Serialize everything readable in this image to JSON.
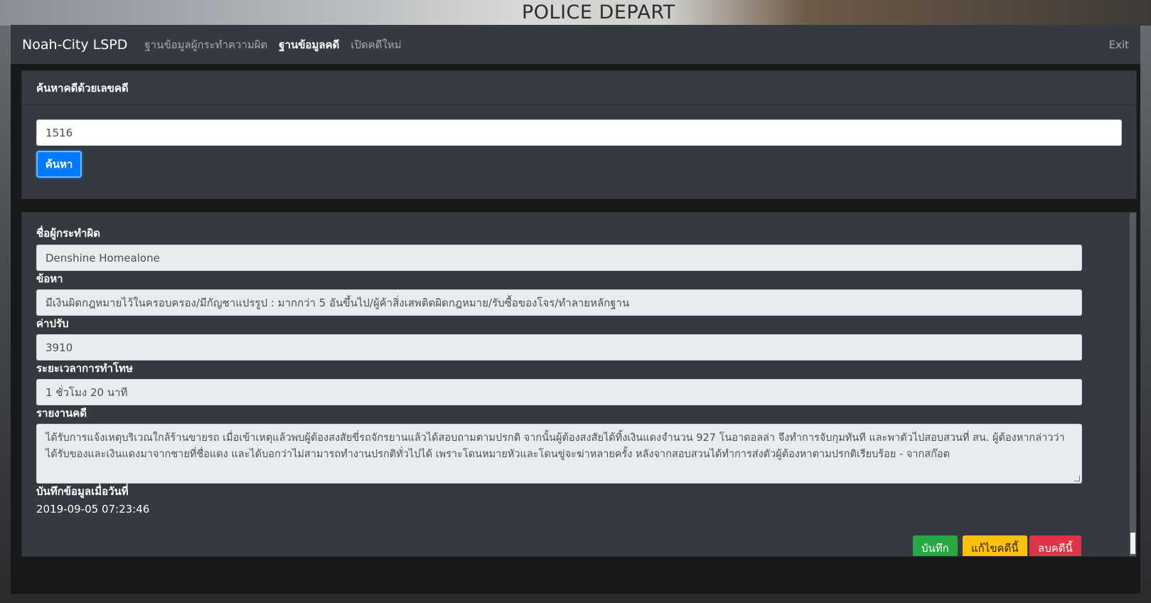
{
  "background": {
    "sign_text": "POLICE DEPART"
  },
  "navbar": {
    "brand": "Noah-City LSPD",
    "links": [
      {
        "label": "ฐานข้อมูลผู้กระทำความผิด",
        "active": false
      },
      {
        "label": "ฐานข้อมูลคดี",
        "active": true
      },
      {
        "label": "เปิดคดีใหม่",
        "active": false
      }
    ],
    "exit_label": "Exit"
  },
  "search": {
    "header": "ค้นหาคดีด้วยเลขคดี",
    "value": "1516",
    "button_label": "ค้นหา"
  },
  "case": {
    "offender_label": "ชื่อผู้กระทำผิด",
    "offender_value": "Denshine Homealone",
    "charge_label": "ข้อหา",
    "charge_value": "มีเงินผิดกฎหมายไว้ในครอบครอง/มีกัญชาแปรรูป : มากกว่า 5 อันขึ้นไป/ผู้ค้าสิ่งเสพติดผิดกฎหมาย/รับซื้อของโจร/ทำลายหลักฐาน",
    "fine_label": "ค่าปรับ",
    "fine_value": "3910",
    "sentence_label": "ระยะเวลาการทำโทษ",
    "sentence_value": "1 ชั่วโมง 20 นาที",
    "report_label": "รายงานคดี",
    "report_value": "ได้รับการแจ้งเหตุบริเวณใกล้ร้านขายรถ เมื่อเข้าเหตุแล้วพบผู้ต้องสงสัยขี่รถจักรยานแล้วได้สอบถามตามปรกติ จากนั้นผู้ต้องสงสัยได้ทิ้งเงินแดงจำนวน 927 โนอาดอลล่า จึงทำการจับกุมทันที และพาตัวไปสอบสวนที่ สน. ผู้ต้องหากล่าวว่า ได้รับของและเงินแดงมาจากชายที่ชื่อแดง และได้บอกว่าไม่สามารถทำงานปรกติทั่วไปได้ เพราะโดนหมายหัวและโดนขู่จะฆ่าหลายครั้ง หลังจากสอบสวนได้ทำการส่งตัวผู้ต้องหาตามปรกติเรียบร้อย - จากสก๊อต",
    "recorded_label": "บันทึกข้อมูลเมื่อวันที่",
    "recorded_value": "2019-09-05 07:23:46"
  },
  "actions": {
    "save_label": "บันทึก",
    "edit_label": "แก้ไขคดีนี้",
    "delete_label": "ลบคดีนี้"
  },
  "colors": {
    "primary": "#007bff",
    "success": "#28a745",
    "warning": "#ffc107",
    "danger": "#dc3545",
    "panel": "#343a40"
  }
}
